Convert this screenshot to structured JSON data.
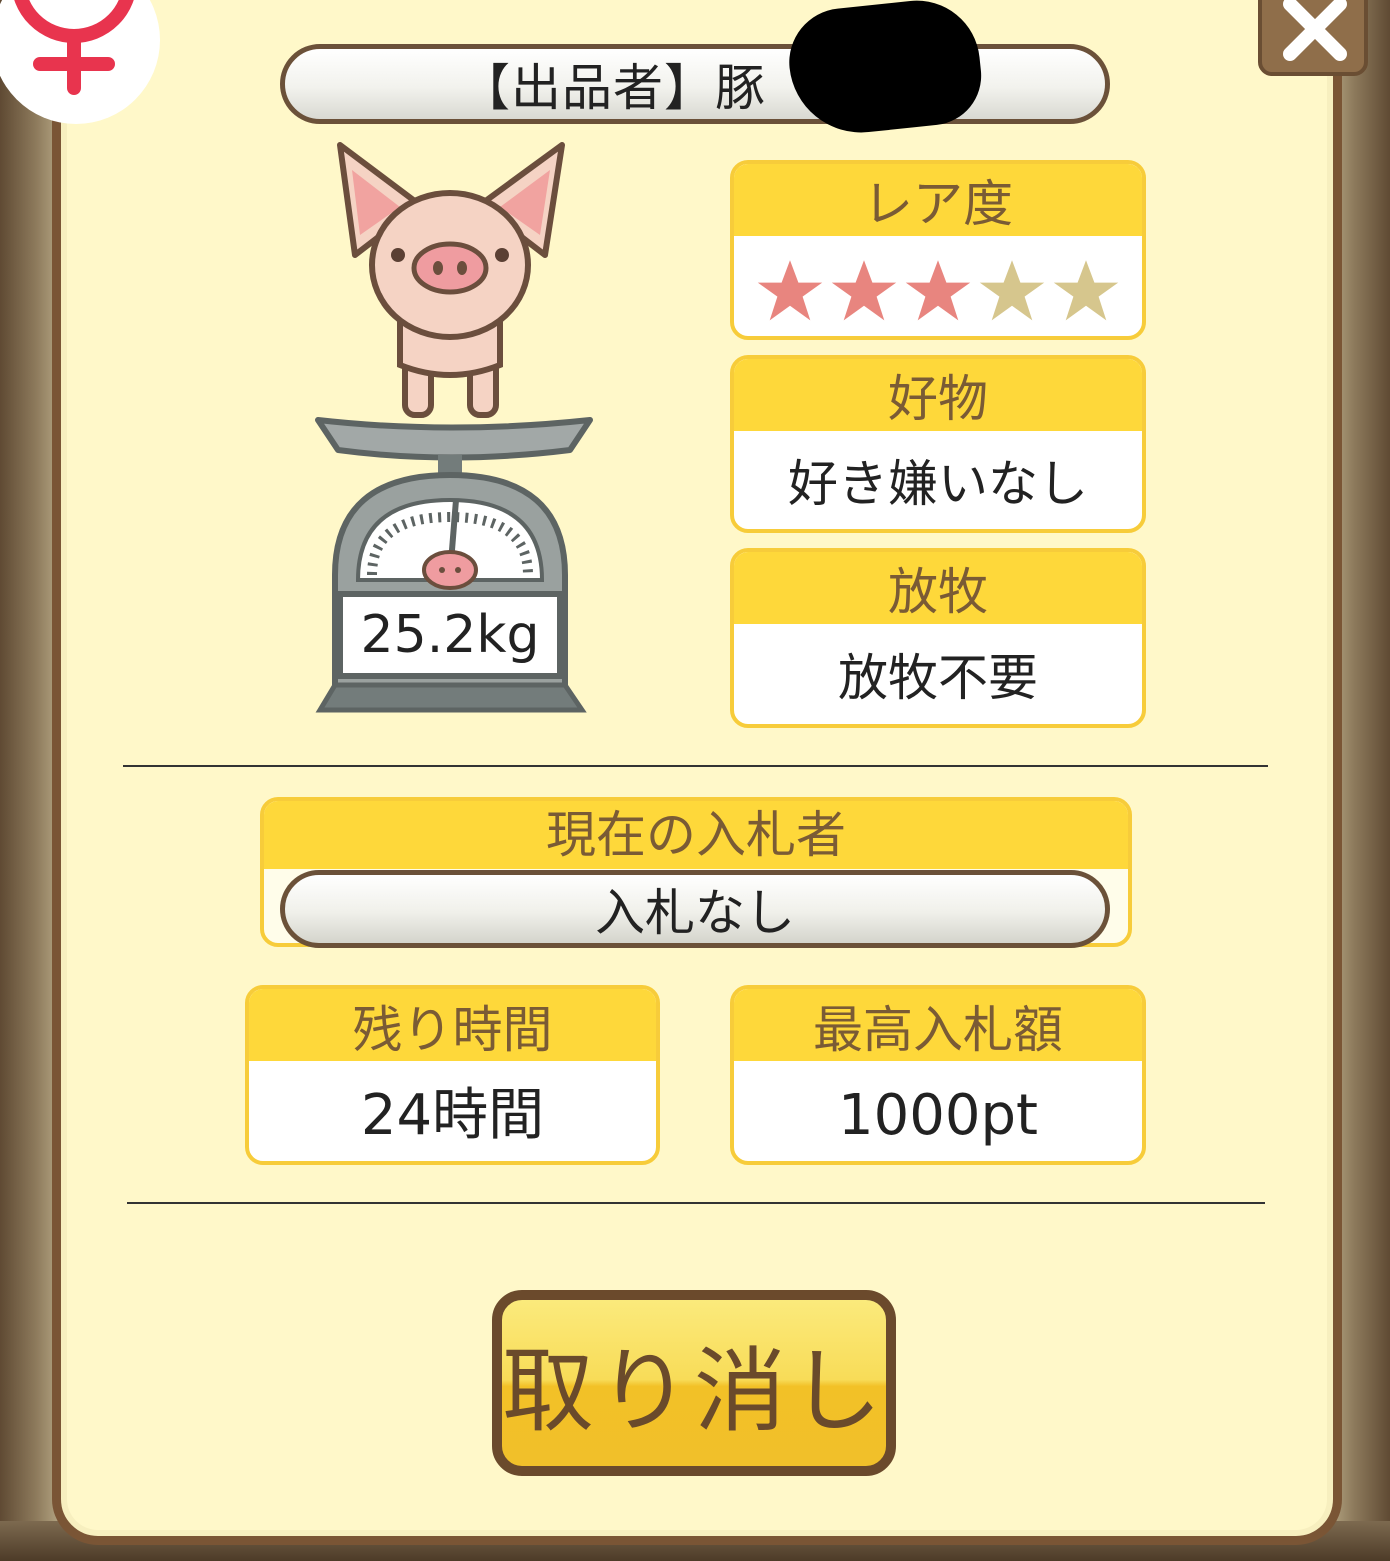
{
  "seller": {
    "label": "【出品者】豚"
  },
  "pig": {
    "weight": "25.2kg"
  },
  "rarity": {
    "label": "レア度",
    "stars_filled": 3,
    "stars_total": 5,
    "star_color_filled": "#e8857f",
    "star_color_empty": "#d6c68d"
  },
  "favorite": {
    "label": "好物",
    "value": "好き嫌いなし"
  },
  "grazing": {
    "label": "放牧",
    "value": "放牧不要"
  },
  "current_bidder": {
    "label": "現在の入札者",
    "value": "入札なし"
  },
  "remaining_time": {
    "label": "残り時間",
    "value": "24時間"
  },
  "highest_bid": {
    "label": "最高入札額",
    "value": "1000pt"
  },
  "cancel_button": {
    "label": "取り消し"
  },
  "colors": {
    "panel_bg": "#fff8c9",
    "frame": "#7a5535",
    "header_yellow": "#fed83a",
    "button_yellow": "#f2c127"
  }
}
